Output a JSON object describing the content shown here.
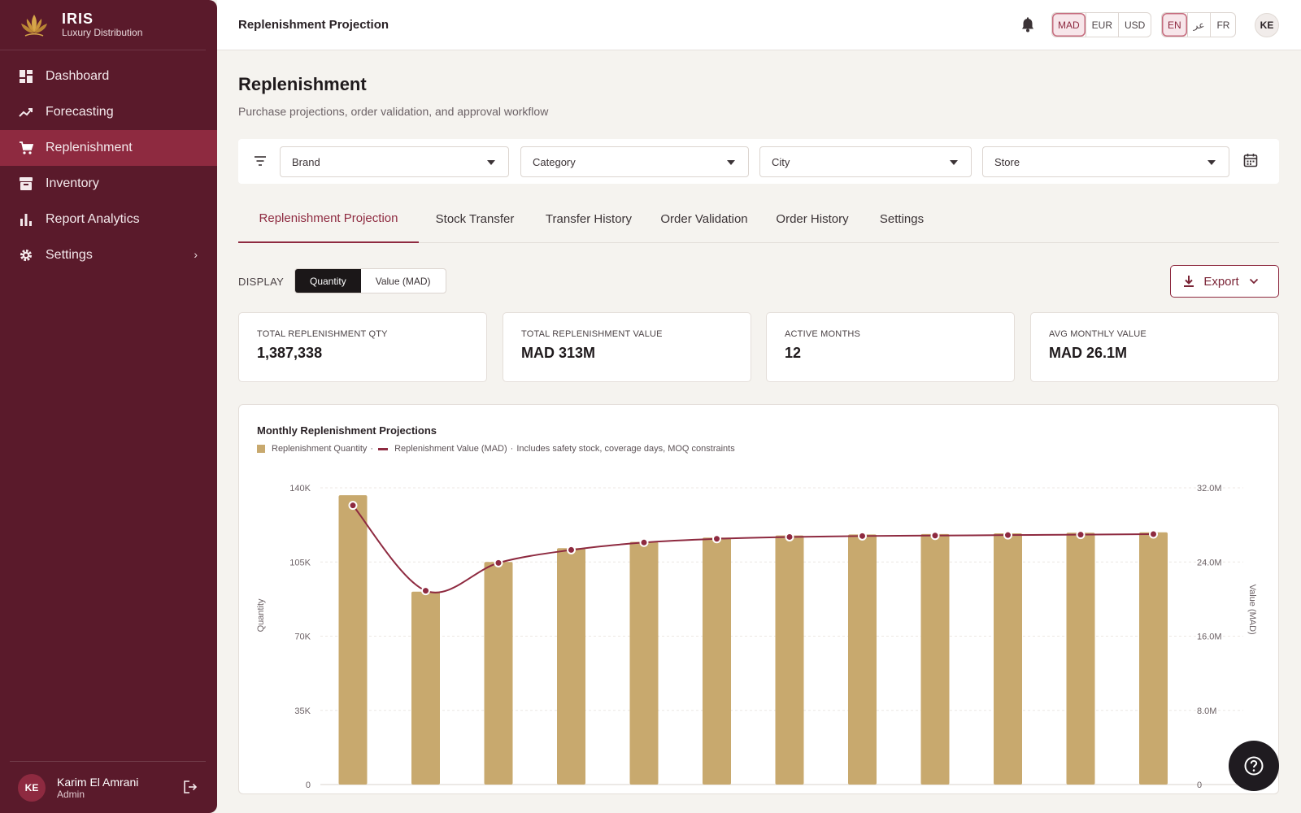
{
  "brand": {
    "name": "IRIS",
    "tagline": "Luxury Distribution"
  },
  "sidebar": {
    "items": [
      {
        "label": "Dashboard",
        "icon": "dashboard-icon"
      },
      {
        "label": "Forecasting",
        "icon": "trend-icon"
      },
      {
        "label": "Replenishment",
        "icon": "cart-icon",
        "active": true
      },
      {
        "label": "Inventory",
        "icon": "archive-icon"
      },
      {
        "label": "Report Analytics",
        "icon": "bar-chart-icon"
      },
      {
        "label": "Settings",
        "icon": "gear-icon"
      }
    ]
  },
  "user": {
    "initials": "KE",
    "name": "Karim El Amrani",
    "role": "Admin"
  },
  "topbar": {
    "title": "Replenishment Projection",
    "currencies": [
      "MAD",
      "EUR",
      "USD"
    ],
    "active_currency": "MAD",
    "languages": [
      "EN",
      "عر",
      "FR"
    ],
    "active_language": "EN",
    "avatar_initials": "KE"
  },
  "page": {
    "title": "Replenishment",
    "subtitle": "Purchase projections, order validation, and approval workflow"
  },
  "filters": {
    "brand": "Brand",
    "category": "Category",
    "city": "City",
    "store": "Store"
  },
  "tabs": [
    "Replenishment Projection",
    "Stock Transfer",
    "Transfer History",
    "Order Validation",
    "Order History",
    "Settings"
  ],
  "display": {
    "label": "DISPLAY",
    "options": [
      "Quantity",
      "Value (MAD)"
    ],
    "active": "Quantity"
  },
  "export_label": "Export",
  "kpis": [
    {
      "label": "TOTAL REPLENISHMENT QTY",
      "value": "1,387,338"
    },
    {
      "label": "TOTAL REPLENISHMENT VALUE",
      "value": "MAD 313M"
    },
    {
      "label": "ACTIVE MONTHS",
      "value": "12"
    },
    {
      "label": "AVG MONTHLY VALUE",
      "value": "MAD 26.1M"
    }
  ],
  "colors": {
    "primary": "#5a1a2b",
    "accent": "#8e2a40",
    "bar": "#c8a96e",
    "background": "#f5f3ef"
  },
  "chart_data": {
    "type": "bar",
    "title": "Monthly Replenishment Projections",
    "legend_note": "Includes safety stock, coverage days, MOQ constraints",
    "ylabel": "Quantity",
    "y2label": "Value (MAD)",
    "ylim": [
      0,
      140000
    ],
    "y2lim": [
      0,
      32000000
    ],
    "yticks": [
      "0",
      "35K",
      "70K",
      "105K",
      "140K"
    ],
    "y2ticks": [
      "0",
      "8.0M",
      "16.0M",
      "24.0M",
      "32.0M"
    ],
    "grid": true,
    "series": [
      {
        "name": "Replenishment Quantity",
        "kind": "bar",
        "values": [
          136500,
          91000,
          105000,
          111500,
          114500,
          116500,
          117500,
          118000,
          118200,
          118500,
          118800,
          119000
        ]
      },
      {
        "name": "Replenishment Value (MAD)",
        "kind": "line",
        "values": [
          30100000,
          20900000,
          23900000,
          25300000,
          26100000,
          26500000,
          26700000,
          26800000,
          26850000,
          26900000,
          26950000,
          27000000
        ]
      }
    ]
  }
}
